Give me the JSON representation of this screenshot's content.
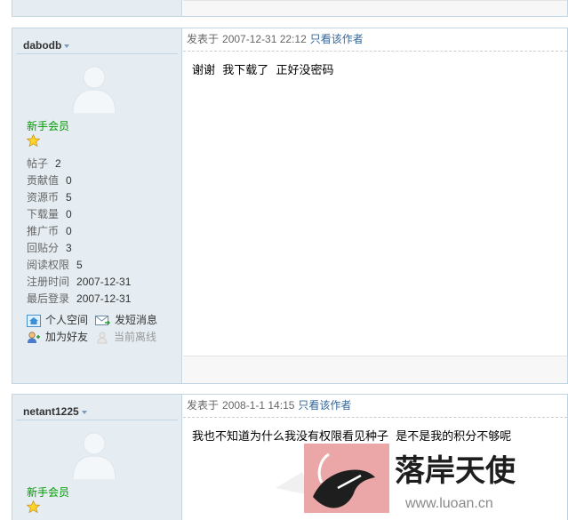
{
  "posts": [
    {
      "author": "dabodb",
      "rank": "新手会员",
      "stats": [
        {
          "key": "帖子",
          "value": "2"
        },
        {
          "key": "贡献值",
          "value": "0"
        },
        {
          "key": "资源币",
          "value": "5"
        },
        {
          "key": "下载量",
          "value": "0"
        },
        {
          "key": "推广币",
          "value": "0"
        },
        {
          "key": "回贴分",
          "value": "3"
        },
        {
          "key": "阅读权限",
          "value": "5"
        },
        {
          "key": "注册时间",
          "value": "2007-12-31"
        },
        {
          "key": "最后登录",
          "value": "2007-12-31"
        }
      ],
      "actions": {
        "space": "个人空间",
        "message": "发短消息",
        "add_friend": "加为好友",
        "status": "当前离线"
      },
      "posted_label": "发表于",
      "posted_time": "2007-12-31 22:12",
      "only_author": "只看该作者",
      "content": "谢谢  我下载了  正好没密码"
    },
    {
      "author": "netant1225",
      "rank": "新手会员",
      "posted_label": "发表于",
      "posted_time": "2008-1-1 14:15",
      "only_author": "只看该作者",
      "content": "我也不知道为什么我没有权限看见种子  是不是我的积分不够呢"
    }
  ],
  "watermark": {
    "text": "落岸天使",
    "url": "www.luoan.cn"
  },
  "colors": {
    "sidebar_bg": "#e5edf2",
    "border": "#c2d5e3",
    "rank": "#009900",
    "link": "#336699"
  }
}
